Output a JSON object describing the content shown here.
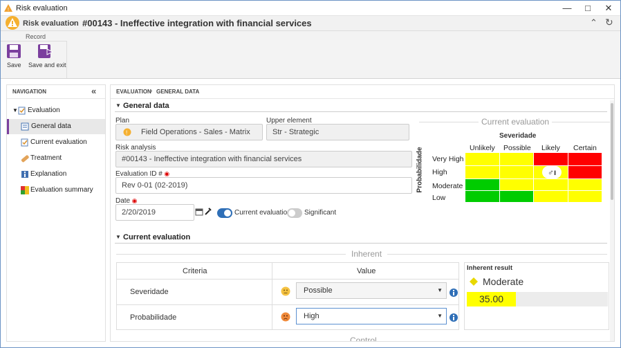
{
  "window": {
    "title": "Risk evaluation"
  },
  "header": {
    "breadcrumb_root": "Risk evaluation",
    "record_title": "#00143 - Ineffective integration with financial services"
  },
  "toolbar": {
    "group_label": "Record",
    "save_label": "Save",
    "save_exit_label": "Save and exit"
  },
  "nav": {
    "title": "NAVIGATION",
    "root": "Evaluation",
    "items": [
      {
        "label": "General data",
        "icon": "document-icon",
        "selected": true
      },
      {
        "label": "Current evaluation",
        "icon": "evaluation-icon",
        "selected": false
      },
      {
        "label": "Treatment",
        "icon": "bandage-icon",
        "selected": false
      },
      {
        "label": "Explanation",
        "icon": "info-icon",
        "selected": false
      },
      {
        "label": "Evaluation summary",
        "icon": "summary-icon",
        "selected": false
      }
    ]
  },
  "main": {
    "breadcrumb": [
      "EVALUATION",
      "GENERAL DATA"
    ],
    "general": {
      "title": "General data",
      "plan_label": "Plan",
      "plan_value": "Field Operations - Sales - Matrix",
      "upper_label": "Upper element",
      "upper_value": "Str - Strategic",
      "analysis_label": "Risk analysis",
      "analysis_value": "#00143 - Ineffective integration with financial services",
      "evalid_label": "Evaluation ID #",
      "evalid_value": "Rev 0-01 (02-2019)",
      "date_label": "Date",
      "date_value": "2/20/2019",
      "toggle_current": "Current evaluation",
      "toggle_significant": "Significant"
    },
    "matrix": {
      "title": "Current evaluation",
      "x_title": "Severidade",
      "y_title": "Probabilidade",
      "columns": [
        "Unlikely",
        "Possible",
        "Likely",
        "Certain"
      ],
      "rows": [
        "Very High",
        "High",
        "Moderate",
        "Low"
      ],
      "colors": {
        "red": "#ff0000",
        "yellow": "#ffff00",
        "green": "#00cc00"
      },
      "marker": "♂ı"
    },
    "current": {
      "title": "Current evaluation",
      "inherent_label": "Inherent",
      "criteria_header": "Criteria",
      "value_header": "Value",
      "rows": [
        {
          "criteria": "Severidade",
          "value": "Possible"
        },
        {
          "criteria": "Probabilidade",
          "value": "High"
        }
      ],
      "result_label": "Inherent result",
      "result_level": "Moderate",
      "result_score": "35.00",
      "control_label": "Control"
    }
  }
}
